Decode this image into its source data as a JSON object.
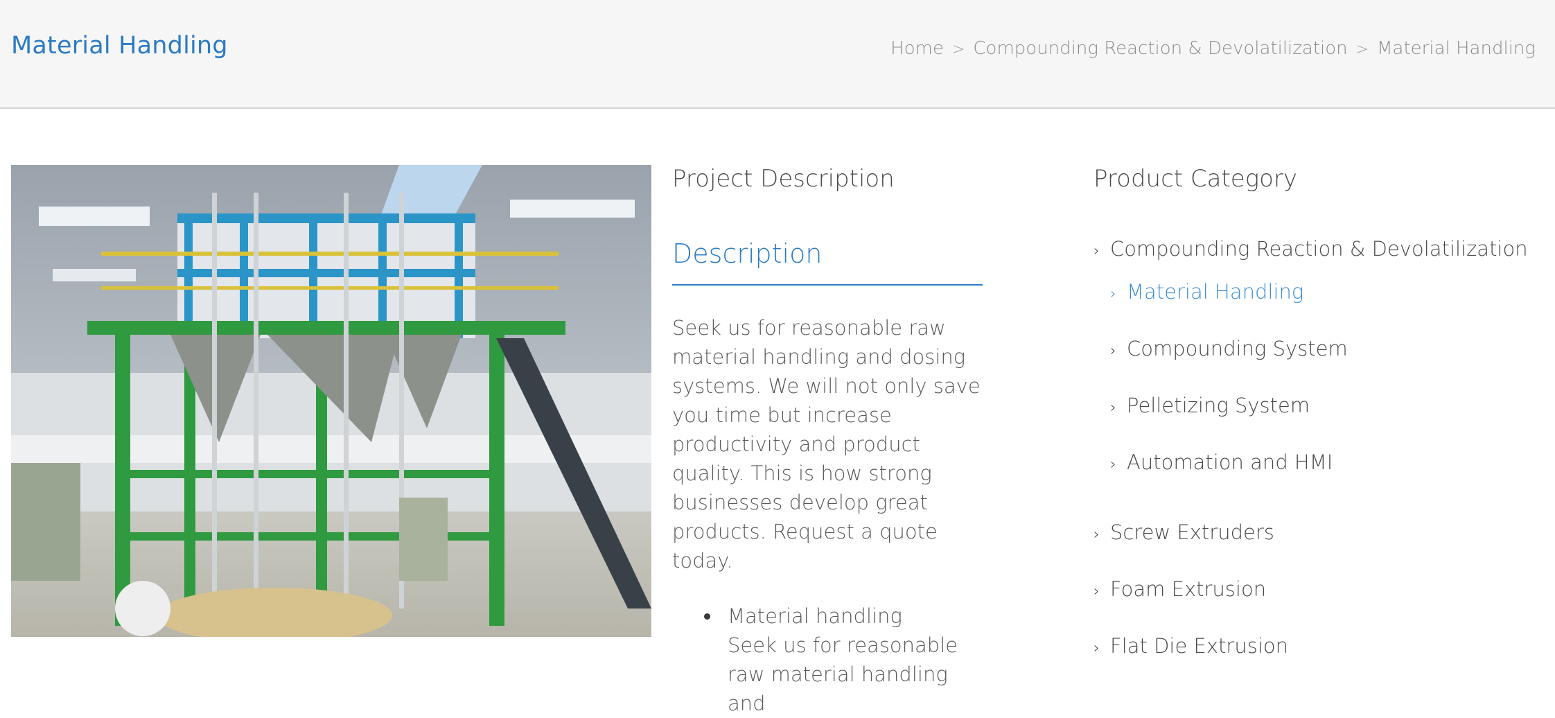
{
  "header": {
    "title": "Material Handling",
    "breadcrumb": [
      "Home",
      "Compounding Reaction & Devolatilization",
      "Material Handling"
    ],
    "separator": ">"
  },
  "project": {
    "section_title": "Project Description",
    "description_title": "Description",
    "body": "Seek us for reasonable raw material handling and dosing systems. We will not only save you time but increase productivity and product quality. This is how strong businesses develop great products. Request a quote today.",
    "list": [
      {
        "title": "Material handling",
        "text": "Seek us for reasonable raw material handling and"
      }
    ]
  },
  "sidebar": {
    "title": "Product Category",
    "items": [
      {
        "label": "Compounding Reaction & Devolatilization",
        "level": 0,
        "active": false
      },
      {
        "label": "Material Handling",
        "level": 1,
        "active": true
      },
      {
        "label": "Compounding System",
        "level": 1,
        "active": false
      },
      {
        "label": "Pelletizing System",
        "level": 1,
        "active": false
      },
      {
        "label": "Automation and HMI",
        "level": 1,
        "active": false
      },
      {
        "label": "Screw Extruders",
        "level": 0,
        "active": false
      },
      {
        "label": "Foam Extrusion",
        "level": 0,
        "active": false
      },
      {
        "label": "Flat Die Extrusion",
        "level": 0,
        "active": false
      }
    ],
    "chevron_icon": "chevron-right-icon"
  },
  "colors": {
    "accent": "#2b7bc4",
    "active_link": "#3d8ed4",
    "header_bg": "#f6f6f6",
    "text": "#4a4a4a"
  }
}
